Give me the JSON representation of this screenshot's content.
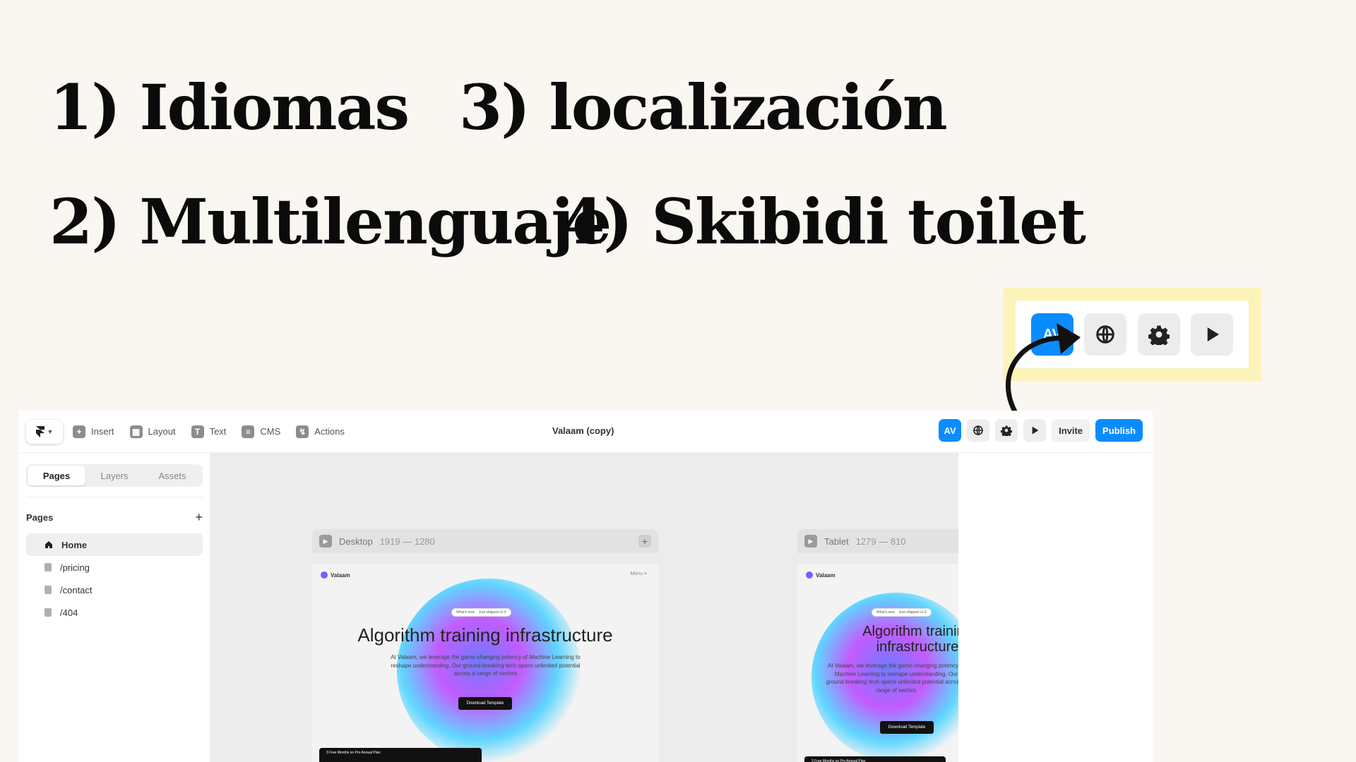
{
  "headline": {
    "opt1": "1) Idiomas",
    "opt2": "2) Multilenguaje",
    "opt3": "3) localización",
    "opt4": "4) Skibidi toilet"
  },
  "callout": {
    "av_label": "AV",
    "icons": [
      "globe-icon",
      "gear-icon",
      "play-icon"
    ]
  },
  "toolbar": {
    "tools": [
      "Insert",
      "Layout",
      "Text",
      "CMS",
      "Actions"
    ],
    "doc_title": "Valaam (copy)",
    "av_label": "AV",
    "invite_label": "Invite",
    "publish_label": "Publish"
  },
  "sidebar": {
    "tabs": [
      "Pages",
      "Layers",
      "Assets"
    ],
    "section_title": "Pages",
    "pages": [
      "Home",
      "/pricing",
      "/contact",
      "/404"
    ]
  },
  "canvas": {
    "desktop": {
      "name": "Desktop",
      "dims": "1919 — 1280"
    },
    "tablet": {
      "name": "Tablet",
      "dims": "1279 — 810"
    },
    "site": {
      "logo": "Valaam",
      "menu": "Menu ≡",
      "pill_left": "What's new",
      "pill_right": "Just shipped v1.0",
      "title": "Algorithm training infrastructure",
      "body": "At Valaam, we leverage the game-changing potency of Machine Learning to reshape understanding. Our ground-breaking tech opens unlimited potential across a range of sectors",
      "cta": "Download Template",
      "promo": "3 Free Months on Pro Annual Plan"
    }
  },
  "colors": {
    "accent": "#0a8cff",
    "highlight": "#fbf3b8",
    "background": "#faf7f2"
  }
}
